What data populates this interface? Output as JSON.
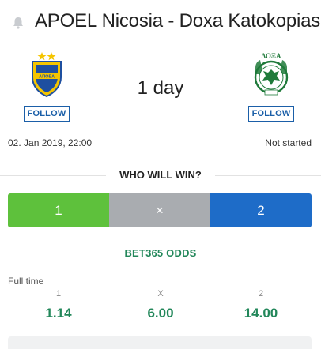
{
  "header": {
    "title": "APOEL Nicosia - Doxa Katokopias",
    "icon": "bell-icon"
  },
  "match": {
    "home_team": {
      "follow_label": "FOLLOW",
      "crest_icon": "apoel-crest-icon",
      "color": "#f5c500"
    },
    "away_team": {
      "follow_label": "FOLLOW",
      "crest_icon": "doxa-crest-icon",
      "color": "#1f7a3a"
    },
    "countdown": "1 day",
    "date": "02. Jan 2019, 22:00",
    "status": "Not started"
  },
  "prediction": {
    "title": "WHO WILL WIN?",
    "options": [
      {
        "label": "1",
        "color": "#5ec13c"
      },
      {
        "label": "×",
        "color": "#a9acb0"
      },
      {
        "label": "2",
        "color": "#1e6cc8"
      }
    ]
  },
  "odds": {
    "title": "BET365  ODDS",
    "period": "Full time",
    "columns": [
      {
        "label": "1",
        "value": "1.14"
      },
      {
        "label": "X",
        "value": "6.00"
      },
      {
        "label": "2",
        "value": "14.00"
      }
    ],
    "accent": "#22875a"
  }
}
